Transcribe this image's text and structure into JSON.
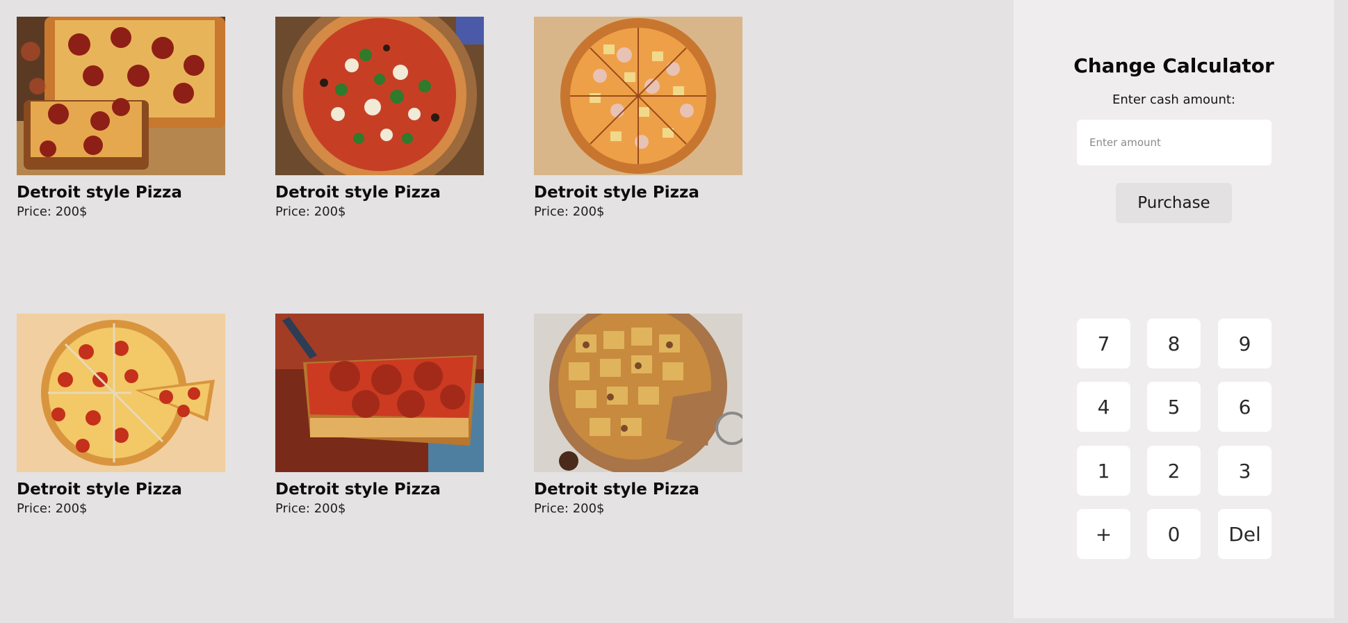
{
  "products": [
    {
      "title": "Detroit style Pizza",
      "price": "Price: 200$",
      "image": "pepperoni-detroit-slices"
    },
    {
      "title": "Detroit style Pizza",
      "price": "Price: 200$",
      "image": "veggie-pizza"
    },
    {
      "title": "Detroit style Pizza",
      "price": "Price: 200$",
      "image": "hawaiian-pizza"
    },
    {
      "title": "Detroit style Pizza",
      "price": "Price: 200$",
      "image": "pepperoni-pizza-slice-pulled"
    },
    {
      "title": "Detroit style Pizza",
      "price": "Price: 200$",
      "image": "detroit-square-slice"
    },
    {
      "title": "Detroit style Pizza",
      "price": "Price: 200$",
      "image": "tavern-style-pizza"
    }
  ],
  "calculator": {
    "title": "Change Calculator",
    "label": "Enter cash amount:",
    "input_placeholder": "Enter amount",
    "input_value": "",
    "purchase_label": "Purchase",
    "keys": [
      "7",
      "8",
      "9",
      "4",
      "5",
      "6",
      "1",
      "2",
      "3",
      "+",
      "0",
      "Del"
    ]
  },
  "colors": {
    "page_background": "#e4e2e3",
    "sidebar_background": "#efedee",
    "key_background": "#ffffff",
    "purchase_background": "#e3e1e2"
  }
}
